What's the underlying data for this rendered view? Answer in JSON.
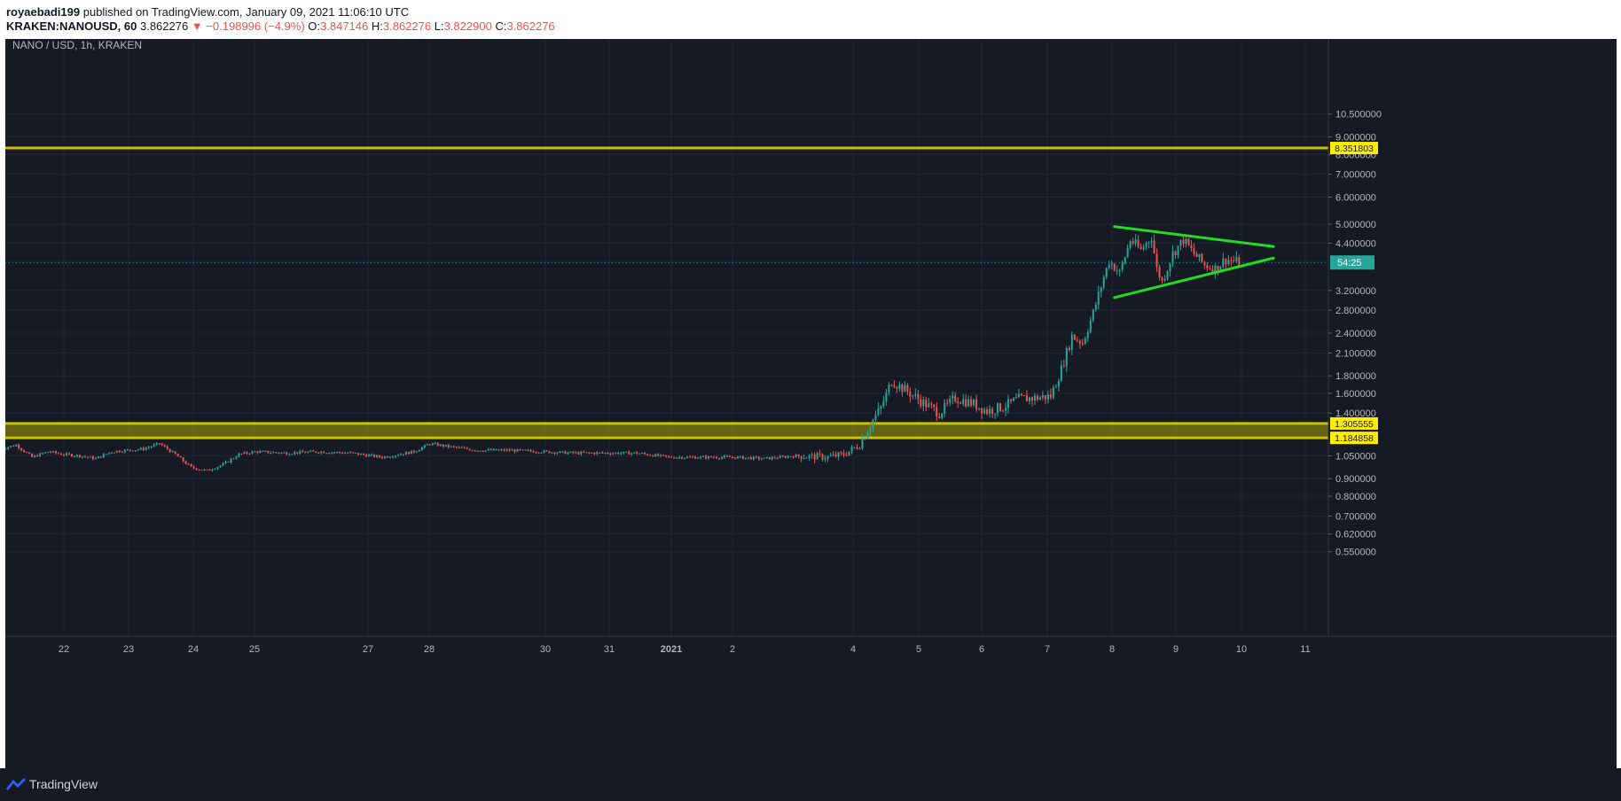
{
  "header": {
    "author": "royaebadi199",
    "published": "published on TradingView.com, January 09, 2021 11:06:10 UTC",
    "symbol": "KRAKEN:NANOUSD, 60",
    "last": "3.862276",
    "change": "−0.198996 (−4.9%)",
    "open_label": "O:",
    "open": "3.847146",
    "high_label": "H:",
    "high": "3.862276",
    "low_label": "L:",
    "low": "3.822900",
    "close_label": "C:",
    "close": "3.862276"
  },
  "footer": {
    "brand": "TradingView"
  },
  "chart_data": {
    "type": "candlestick",
    "title": "NANO / USD, 1h, KRAKEN",
    "y_scale": "log",
    "ylim": [
      0.5,
      10.5
    ],
    "y_ticks": [
      "10.500000",
      "9.000000",
      "8.000000",
      "7.000000",
      "6.000000",
      "5.000000",
      "4.400000",
      "3.200000",
      "2.800000",
      "2.400000",
      "2.100000",
      "1.800000",
      "1.600000",
      "1.400000",
      "1.050000",
      "0.900000",
      "0.800000",
      "0.700000",
      "0.620000",
      "0.550000"
    ],
    "x_ticks": [
      "22",
      "23",
      "24",
      "25",
      "27",
      "28",
      "30",
      "31",
      "2021",
      "2",
      "4",
      "5",
      "6",
      "7",
      "8",
      "9",
      "10",
      "11"
    ],
    "current_price": 3.862276,
    "countdown_label": "54:25",
    "horizontal_levels": [
      {
        "value": 8.351803,
        "label": "8.351803"
      },
      {
        "value": 1.305555,
        "label": "1.305555"
      },
      {
        "value": 1.184858,
        "label": "1.184858"
      }
    ],
    "zone": {
      "low": 1.184858,
      "high": 1.305555
    },
    "triangle": {
      "upper": {
        "from": [
          "Jan 7 12:00",
          4.92
        ],
        "to": [
          "Jan 10",
          4.3
        ]
      },
      "lower": {
        "from": [
          "Jan 7 12:00",
          3.05
        ],
        "to": [
          "Jan 10",
          3.98
        ]
      }
    },
    "path": [
      [
        "Dec 21 00:00",
        1.1
      ],
      [
        "Dec 21 06:00",
        1.13
      ],
      [
        "Dec 21 12:00",
        1.04
      ],
      [
        "Dec 21 18:00",
        1.08
      ],
      [
        "Dec 22 00:00",
        1.06
      ],
      [
        "Dec 22 06:00",
        1.05
      ],
      [
        "Dec 22 12:00",
        1.03
      ],
      [
        "Dec 22 18:00",
        1.08
      ],
      [
        "Dec 23 00:00",
        1.09
      ],
      [
        "Dec 23 06:00",
        1.1
      ],
      [
        "Dec 23 12:00",
        1.14
      ],
      [
        "Dec 23 18:00",
        1.06
      ],
      [
        "Dec 24 00:00",
        0.97
      ],
      [
        "Dec 24 06:00",
        0.95
      ],
      [
        "Dec 24 12:00",
        0.99
      ],
      [
        "Dec 24 18:00",
        1.06
      ],
      [
        "Dec 25 00:00",
        1.08
      ],
      [
        "Dec 25 12:00",
        1.07
      ],
      [
        "Dec 26 00:00",
        1.08
      ],
      [
        "Dec 26 12:00",
        1.07
      ],
      [
        "Dec 27 00:00",
        1.04
      ],
      [
        "Dec 27 12:00",
        1.08
      ],
      [
        "Dec 27 18:00",
        1.14
      ],
      [
        "Dec 28 00:00",
        1.12
      ],
      [
        "Dec 28 12:00",
        1.09
      ],
      [
        "Dec 29 00:00",
        1.09
      ],
      [
        "Dec 29 12:00",
        1.08
      ],
      [
        "Dec 30 00:00",
        1.07
      ],
      [
        "Dec 30 12:00",
        1.07
      ],
      [
        "Dec 31 00:00",
        1.07
      ],
      [
        "Dec 31 12:00",
        1.04
      ],
      [
        "Jan 1 00:00",
        1.04
      ],
      [
        "Jan 1 12:00",
        1.04
      ],
      [
        "Jan 2 00:00",
        1.03
      ],
      [
        "Jan 2 12:00",
        1.05
      ],
      [
        "Jan 3 00:00",
        1.04
      ],
      [
        "Jan 3 06:00",
        1.06
      ],
      [
        "Jan 3 12:00",
        1.13
      ],
      [
        "Jan 3 16:00",
        1.3
      ],
      [
        "Jan 3 20:00",
        1.45
      ],
      [
        "Jan 4 00:00",
        1.74
      ],
      [
        "Jan 4 06:00",
        1.62
      ],
      [
        "Jan 4 12:00",
        1.5
      ],
      [
        "Jan 4 18:00",
        1.4
      ],
      [
        "Jan 5 00:00",
        1.55
      ],
      [
        "Jan 5 06:00",
        1.5
      ],
      [
        "Jan 5 12:00",
        1.42
      ],
      [
        "Jan 5 18:00",
        1.46
      ],
      [
        "Jan 6 00:00",
        1.54
      ],
      [
        "Jan 6 06:00",
        1.55
      ],
      [
        "Jan 6 12:00",
        1.57
      ],
      [
        "Jan 6 16:00",
        1.88
      ],
      [
        "Jan 6 20:00",
        2.35
      ],
      [
        "Jan 7 00:00",
        2.25
      ],
      [
        "Jan 7 04:00",
        2.75
      ],
      [
        "Jan 7 08:00",
        3.5
      ],
      [
        "Jan 7 10:00",
        3.9
      ],
      [
        "Jan 7 14:00",
        3.6
      ],
      [
        "Jan 7 18:00",
        4.5
      ],
      [
        "Jan 7 22:00",
        4.2
      ],
      [
        "Jan 8 02:00",
        4.6
      ],
      [
        "Jan 8 04:00",
        3.7
      ],
      [
        "Jan 8 06:00",
        3.4
      ],
      [
        "Jan 8 10:00",
        4.1
      ],
      [
        "Jan 8 14:00",
        4.5
      ],
      [
        "Jan 8 18:00",
        4.1
      ],
      [
        "Jan 8 22:00",
        3.8
      ],
      [
        "Jan 9 02:00",
        3.7
      ],
      [
        "Jan 9 06:00",
        3.95
      ],
      [
        "Jan 9 11:00",
        3.86
      ]
    ]
  }
}
